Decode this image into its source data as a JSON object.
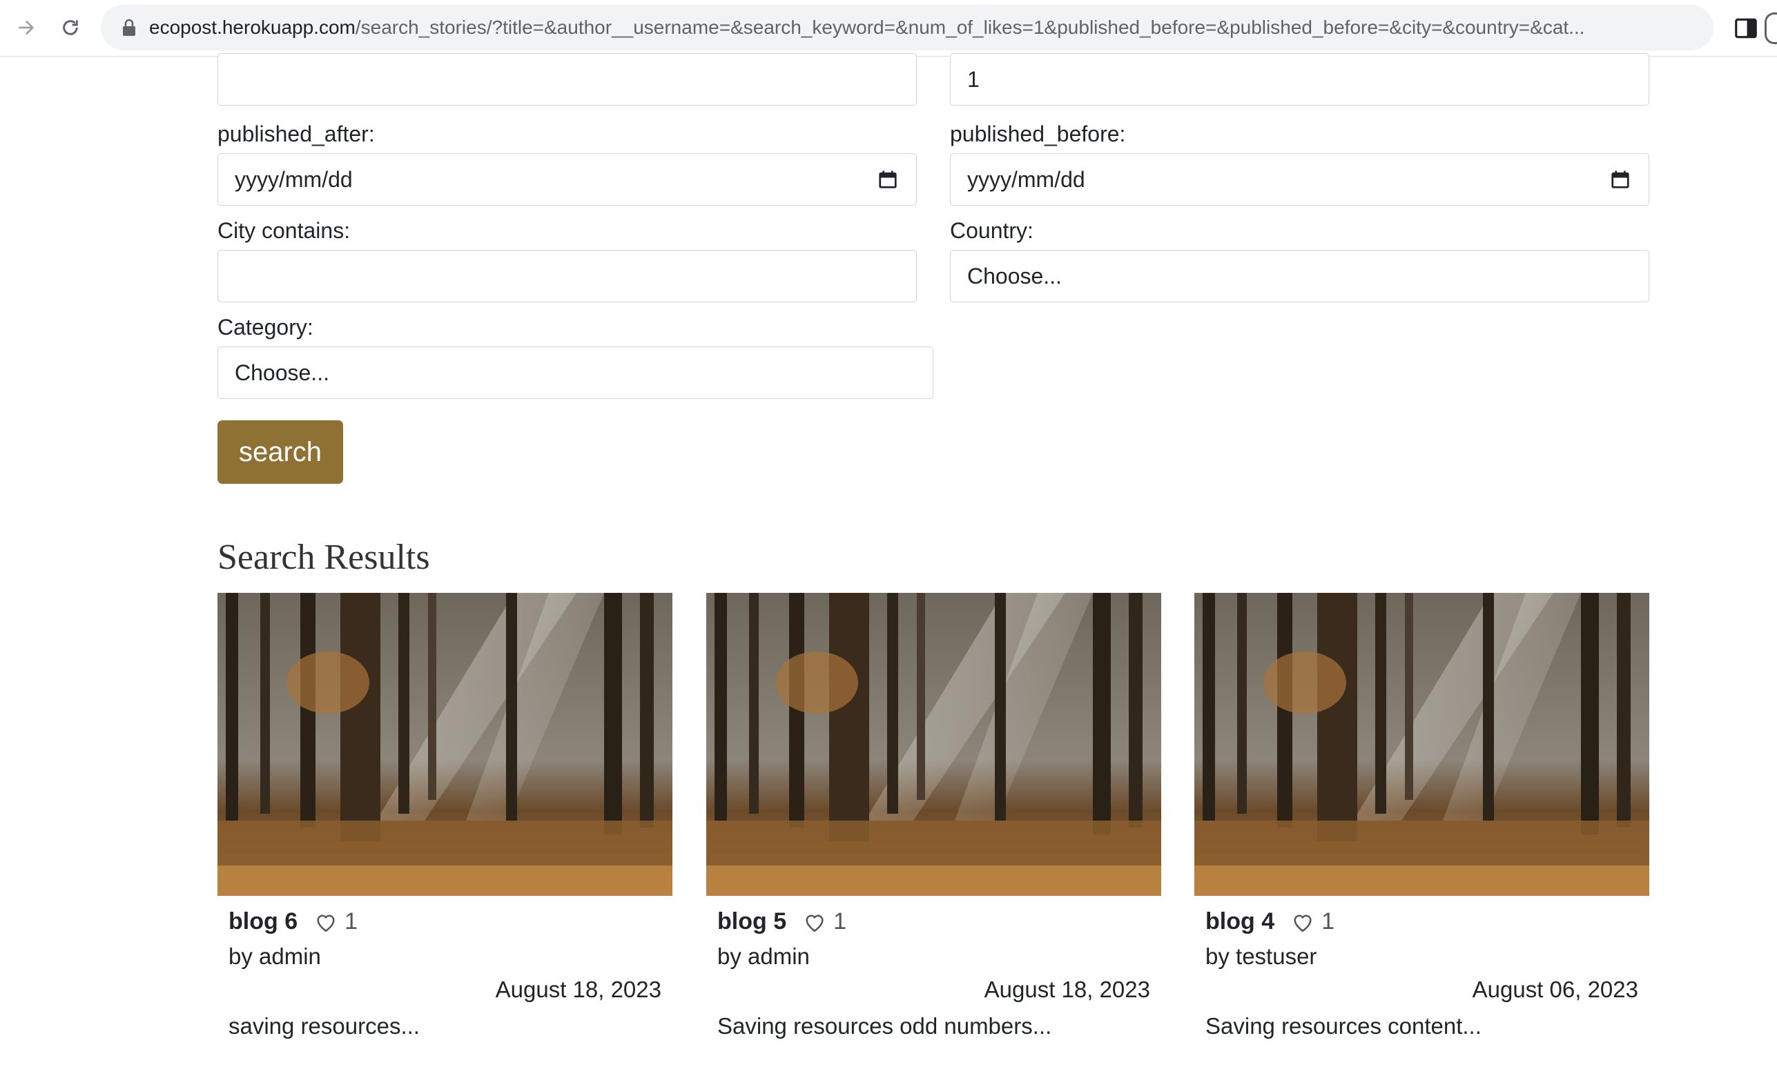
{
  "browser": {
    "url_host": "ecopost.herokuapp.com",
    "url_path": "/search_stories/?title=&author__username=&search_keyword=&num_of_likes=1&published_before=&published_before=&city=&country=&cat..."
  },
  "form": {
    "top_left_value": "",
    "top_right_value": "1",
    "published_after_label": "published_after:",
    "published_after_placeholder": "yyyy/mm/dd",
    "published_before_label": "published_before:",
    "published_before_placeholder": "yyyy/mm/dd",
    "city_label": "City contains:",
    "city_value": "",
    "country_label": "Country:",
    "country_value": "Choose...",
    "category_label": "Category:",
    "category_value": "Choose...",
    "search_label": "search"
  },
  "results": {
    "title": "Search Results",
    "cards": [
      {
        "title": "blog 6",
        "likes": "1",
        "author": "by admin",
        "date": "August 18, 2023",
        "excerpt": "saving resources..."
      },
      {
        "title": "blog 5",
        "likes": "1",
        "author": "by admin",
        "date": "August 18, 2023",
        "excerpt": "Saving resources odd numbers..."
      },
      {
        "title": "blog 4",
        "likes": "1",
        "author": "by testuser",
        "date": "August 06, 2023",
        "excerpt": "Saving resources content..."
      }
    ]
  },
  "colors": {
    "accent": "#8f7133"
  }
}
